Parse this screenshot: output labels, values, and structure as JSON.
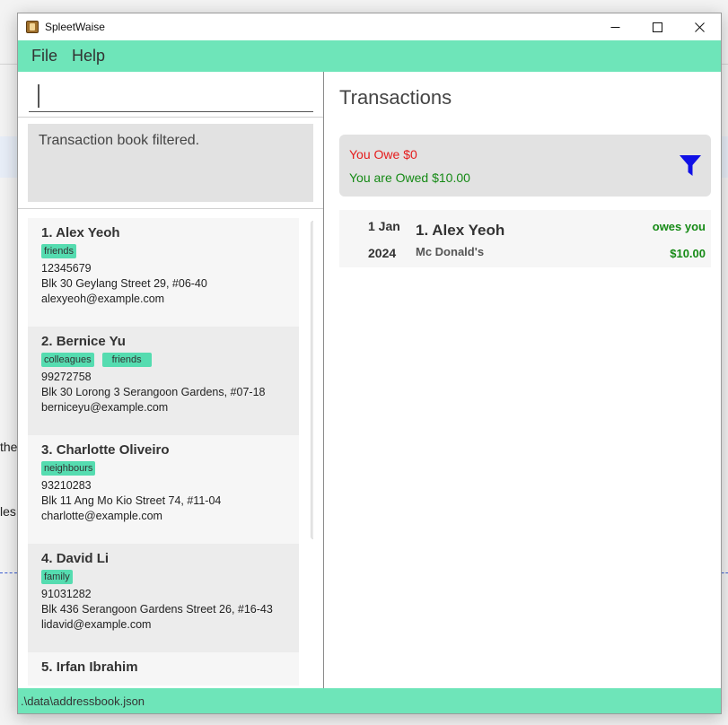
{
  "window": {
    "title": "SpleetWaise"
  },
  "menu": {
    "file": "File",
    "help": "Help"
  },
  "command": {
    "value": "",
    "placeholder": ""
  },
  "result": {
    "message": "Transaction book filtered."
  },
  "persons": [
    {
      "index": "1.",
      "name": "Alex Yeoh",
      "tags": [
        "friends"
      ],
      "phone": "12345679",
      "address": "Blk 30 Geylang Street 29, #06-40",
      "email": "alexyeoh@example.com"
    },
    {
      "index": "2.",
      "name": "Bernice Yu",
      "tags": [
        "colleagues",
        "friends"
      ],
      "phone": "99272758",
      "address": "Blk 30 Lorong 3 Serangoon Gardens, #07-18",
      "email": "berniceyu@example.com"
    },
    {
      "index": "3.",
      "name": "Charlotte Oliveiro",
      "tags": [
        "neighbours"
      ],
      "phone": "93210283",
      "address": "Blk 11 Ang Mo Kio Street 74, #11-04",
      "email": "charlotte@example.com"
    },
    {
      "index": "4.",
      "name": "David Li",
      "tags": [
        "family"
      ],
      "phone": "91031282",
      "address": "Blk 436 Serangoon Gardens Street 26, #16-43",
      "email": "lidavid@example.com"
    },
    {
      "index": "5.",
      "name": "Irfan Ibrahim",
      "tags": [],
      "phone": "",
      "address": "",
      "email": ""
    }
  ],
  "transactions_panel": {
    "title": "Transactions",
    "summary": {
      "owe": "You Owe $0",
      "owed": "You are Owed $10.00"
    },
    "items": [
      {
        "day": "1 Jan",
        "year": "2024",
        "name": "1. Alex Yeoh",
        "description": "Mc Donald's",
        "status": "owes you",
        "amount": "$10.00"
      }
    ]
  },
  "status": {
    "path": ".\\data\\addressbook.json"
  },
  "background": {
    "snippet1": "the",
    "snippet2": "les"
  },
  "colors": {
    "accent": "#6ee5b9",
    "tag": "#55dcb0",
    "owe": "#e51c1c",
    "owed": "#158a15",
    "filter": "#1010e6"
  },
  "icons": {
    "app": "app-icon",
    "filter": "filter-icon",
    "minimize": "minimize-icon",
    "maximize": "maximize-icon",
    "close": "close-icon"
  }
}
